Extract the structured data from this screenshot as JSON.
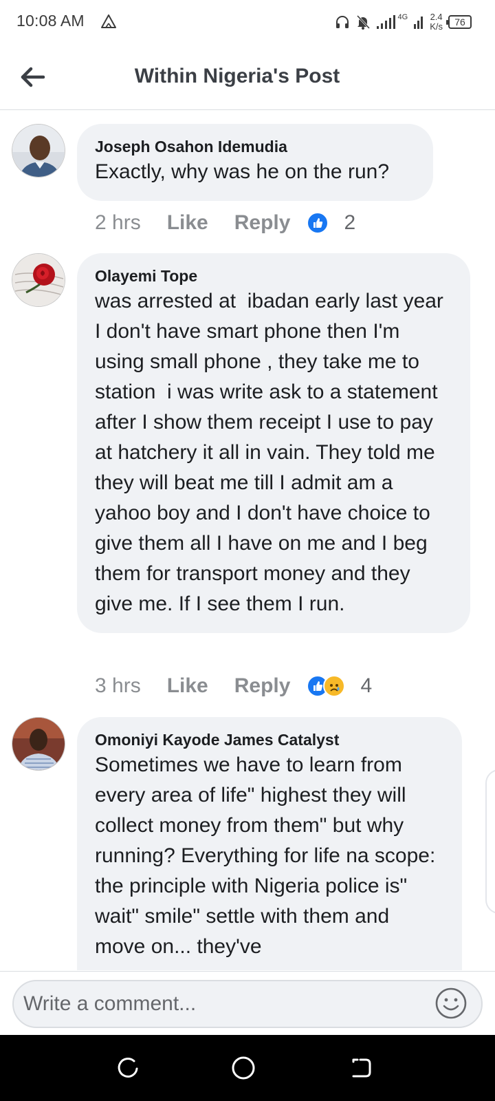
{
  "status_bar": {
    "time": "10:08 AM",
    "network": "4G",
    "speed_value": "2.4",
    "speed_unit": "K/s",
    "battery": "76"
  },
  "header": {
    "title": "Within Nigeria's Post"
  },
  "comments": [
    {
      "author": "Joseph Osahon Idemudia",
      "text": "Exactly, why was he on the run?",
      "time": "2 hrs",
      "like_label": "Like",
      "reply_label": "Reply",
      "reactions": [
        "like"
      ],
      "reaction_count": "2"
    },
    {
      "author": "Olayemi Tope",
      "text": "was arrested at  ibadan early last year I don't have smart phone then I'm using small phone , they take me to station  i was write ask to a statement after I show them receipt I use to pay at hatchery it all in vain. They told me they will beat me till I admit am a yahoo boy and I don't have choice to give them all I have on me and I beg them for transport money and they give me. If I see them I run.",
      "time": "3 hrs",
      "like_label": "Like",
      "reply_label": "Reply",
      "reactions": [
        "like",
        "sad"
      ],
      "reaction_count": "4"
    },
    {
      "author": "Omoniyi Kayode James Catalyst",
      "text": "Sometimes we have to learn from every area of life\" highest they will collect money from them\" but why running? Everything for life na scope: the principle with Nigeria police is\" wait\" smile\" settle with them and move on... they've"
    }
  ],
  "composer": {
    "placeholder": "Write a comment..."
  },
  "colors": {
    "bubble": "#f0f2f5",
    "like_blue": "#1877f2",
    "meta_gray": "#8a8d91"
  },
  "icons": [
    "back-arrow-icon",
    "alert-triangle-icon",
    "headphones-icon",
    "bell-muted-icon",
    "signal-icon",
    "like-reaction-icon",
    "sad-reaction-icon",
    "emoji-icon",
    "recents-icon",
    "home-icon",
    "back-nav-icon"
  ]
}
